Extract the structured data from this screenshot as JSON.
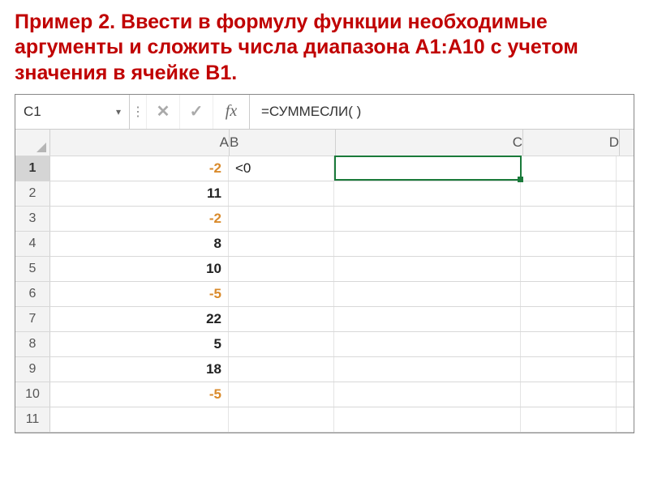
{
  "instruction": "Пример 2. Ввести в формулу функции необходимые аргументы  и сложить числа диапазона A1:A10 с учетом значения в ячейке B1.",
  "formula_bar": {
    "name_box": "C1",
    "cancel": "✕",
    "accept": "✓",
    "fx": "fx",
    "formula": "=СУММЕСЛИ(                        )"
  },
  "columns": [
    "A",
    "B",
    "C",
    "D"
  ],
  "row_numbers": [
    "1",
    "2",
    "3",
    "4",
    "5",
    "6",
    "7",
    "8",
    "9",
    "10",
    "11"
  ],
  "cells": {
    "A1": {
      "v": "-2",
      "cls": "neg bold"
    },
    "A2": {
      "v": "11",
      "cls": "bold"
    },
    "A3": {
      "v": "-2",
      "cls": "neg bold"
    },
    "A4": {
      "v": "8",
      "cls": "bold"
    },
    "A5": {
      "v": "10",
      "cls": "bold"
    },
    "A6": {
      "v": "-5",
      "cls": "neg bold"
    },
    "A7": {
      "v": "22",
      "cls": "bold"
    },
    "A8": {
      "v": "5",
      "cls": "bold"
    },
    "A9": {
      "v": "18",
      "cls": "bold"
    },
    "A10": {
      "v": "-5",
      "cls": "neg bold"
    },
    "B1": {
      "v": "<0",
      "cls": ""
    }
  },
  "active_cell": "C1",
  "chart_data": {
    "type": "table",
    "title": "Пример 2 — СУММЕСЛИ",
    "columns": [
      "A",
      "B"
    ],
    "rows": [
      {
        "A": -2,
        "B": "<0"
      },
      {
        "A": 11
      },
      {
        "A": -2
      },
      {
        "A": 8
      },
      {
        "A": 10
      },
      {
        "A": -5
      },
      {
        "A": 22
      },
      {
        "A": 5
      },
      {
        "A": 18
      },
      {
        "A": -5
      }
    ],
    "formula_in_C1": "=СУММЕСЛИ( )"
  }
}
